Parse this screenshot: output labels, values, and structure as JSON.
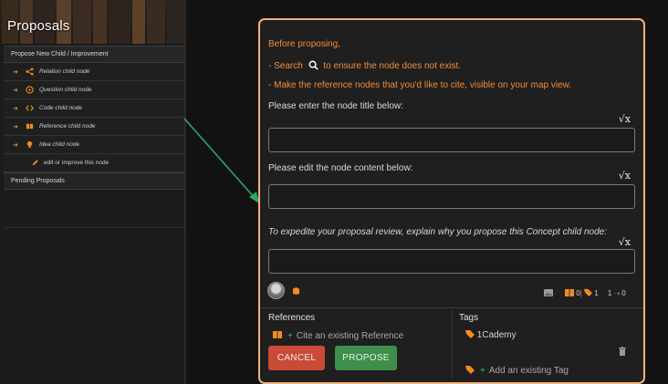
{
  "left_panel": {
    "title": "Proposals",
    "section_propose": "Propose New Child / Improvement",
    "items": [
      {
        "label": "Relation child node",
        "icon": "share-icon"
      },
      {
        "label": "Question child node",
        "icon": "question-icon"
      },
      {
        "label": "Code child node",
        "icon": "code-icon"
      },
      {
        "label": "Reference child node",
        "icon": "book-icon"
      },
      {
        "label": "Idea child node",
        "icon": "lightbulb-icon"
      }
    ],
    "edit_label": "edit or improve this node",
    "section_pending": "Pending Proposals"
  },
  "instructions": {
    "before": "Before proposing,",
    "search_prefix": "- Search",
    "search_suffix": "to ensure the node does not exist.",
    "references": "- Make the reference nodes that you'd like to cite, visible on your map view."
  },
  "fields": {
    "title_label": "Please enter the node title below:",
    "content_label": "Please edit the node content below:",
    "reason_label": "To expedite your proposal review, explain why you propose this Concept child node:",
    "math_symbol": "√x"
  },
  "stats": {
    "references_count": "0",
    "tags_count": "1",
    "links_text": "1 ⤑ 0"
  },
  "references": {
    "heading": "References",
    "cite_label": "Cite an existing Reference"
  },
  "tags": {
    "heading": "Tags",
    "items": [
      "1Cademy"
    ],
    "add_label": "Add an existing Tag"
  },
  "buttons": {
    "cancel": "CANCEL",
    "propose": "PROPOSE"
  },
  "colors": {
    "accent_orange": "#f28c3a",
    "card_border": "#f1b47a",
    "cancel": "#c94a36",
    "propose": "#3f8f4c",
    "pointer_arrow": "#2fa56a"
  }
}
